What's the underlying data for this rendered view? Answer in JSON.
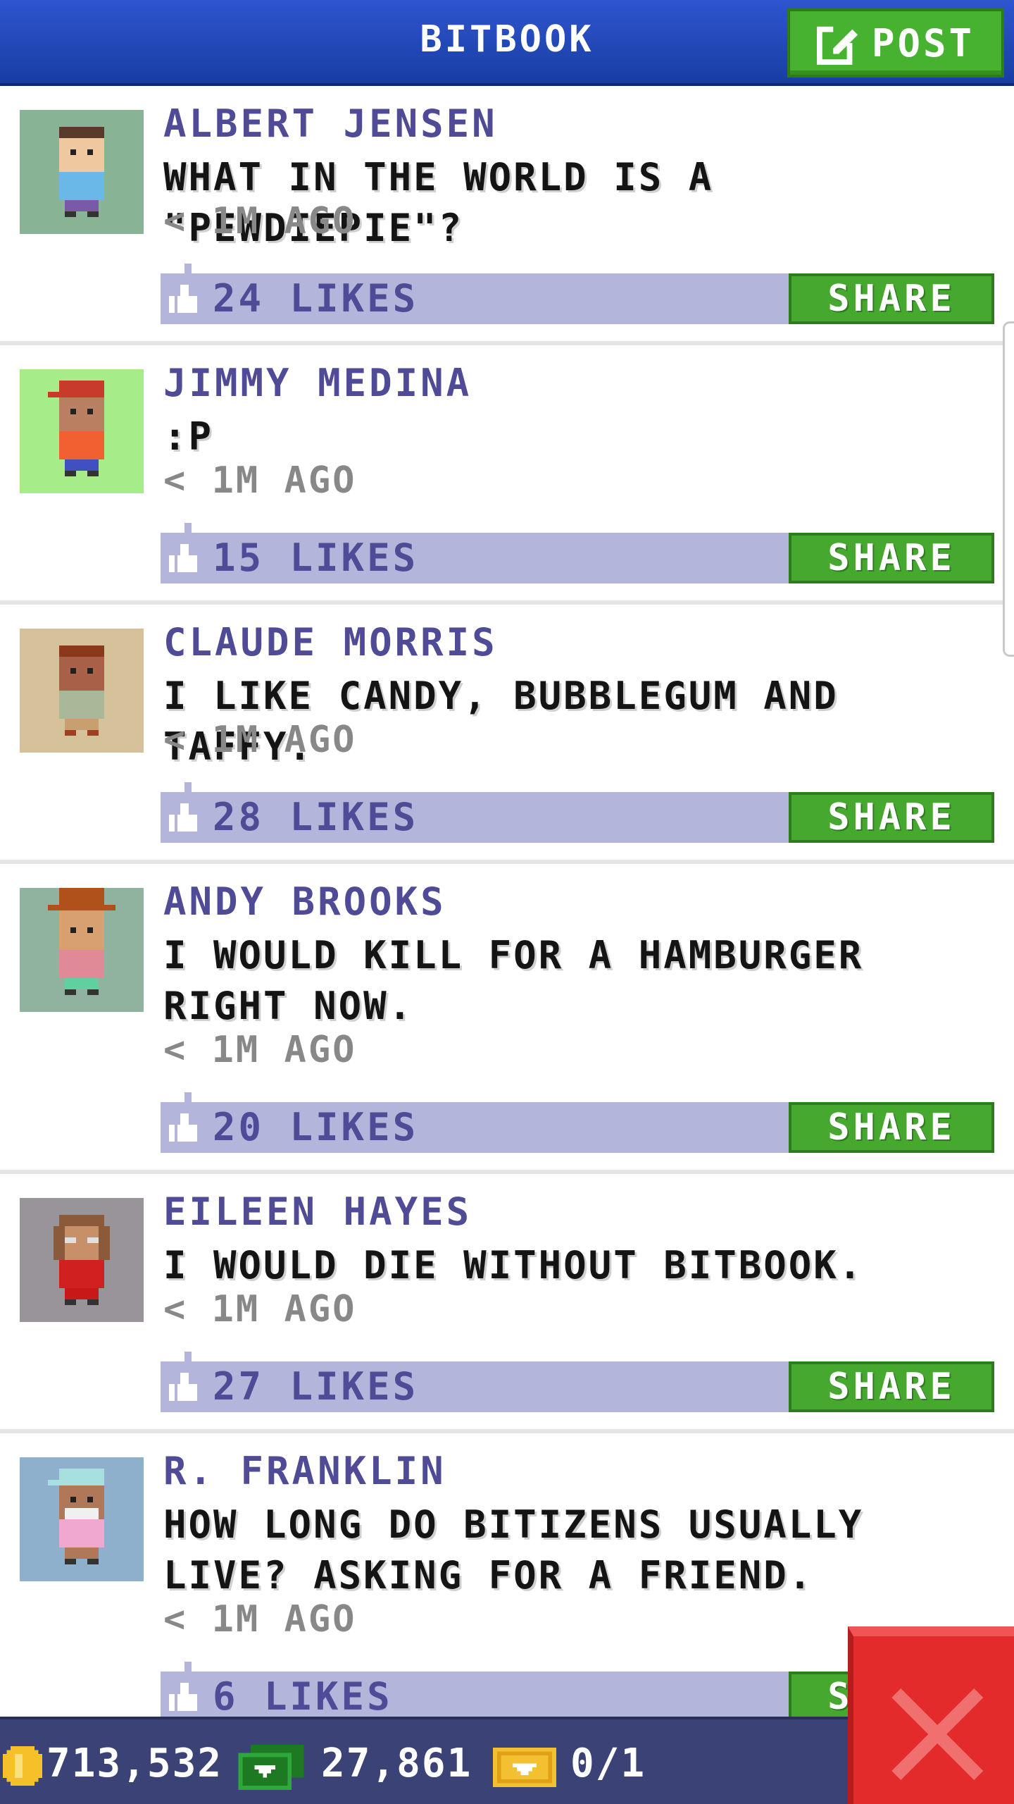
{
  "header": {
    "title": "BITBOOK",
    "post_label": "POST"
  },
  "posts": [
    {
      "author": "ALBERT JENSEN",
      "message": "WHAT IN THE WORLD IS A \"PEWDIEPIE\"?",
      "time": "< 1M AGO",
      "likes": "24 LIKES",
      "share": "SHARE",
      "avatar": "bitizen-avatar"
    },
    {
      "author": "JIMMY MEDINA",
      "message": ":P",
      "time": "< 1M AGO",
      "likes": "15 LIKES",
      "share": "SHARE",
      "avatar": "bitizen-avatar"
    },
    {
      "author": "CLAUDE MORRIS",
      "message": "I LIKE CANDY, BUBBLEGUM AND TAFFY.",
      "time": "< 1M AGO",
      "likes": "28 LIKES",
      "share": "SHARE",
      "avatar": "bitizen-avatar"
    },
    {
      "author": "ANDY BROOKS",
      "message": "I WOULD KILL FOR A HAMBURGER RIGHT NOW.",
      "time": "< 1M AGO",
      "likes": "20 LIKES",
      "share": "SHARE",
      "avatar": "bitizen-avatar"
    },
    {
      "author": "EILEEN HAYES",
      "message": "I WOULD DIE WITHOUT BITBOOK.",
      "time": "< 1M AGO",
      "likes": "27 LIKES",
      "share": "SHARE",
      "avatar": "bitizen-avatar"
    },
    {
      "author": "R. FRANKLIN",
      "message": "HOW LONG DO BITIZENS USUALLY LIVE? ASKING FOR A FRIEND.",
      "time": "< 1M AGO",
      "likes": "6 LIKES",
      "share": "SHARE",
      "avatar": "bitizen-avatar"
    }
  ],
  "footer": {
    "coins": "713,532",
    "bux": "27,861",
    "tickets": "0/1"
  },
  "icons": {
    "post": "edit-icon",
    "like": "thumbs-up-icon",
    "coin": "coin-icon",
    "bux": "bux-icon",
    "ticket": "ticket-icon",
    "close": "close-icon"
  },
  "colors": {
    "header": "#2f55cf",
    "button_green": "#46b22f",
    "like_bar": "#b3b6da",
    "author": "#4f4b96",
    "close_red": "#e32b2b",
    "footer": "#3b4276"
  }
}
